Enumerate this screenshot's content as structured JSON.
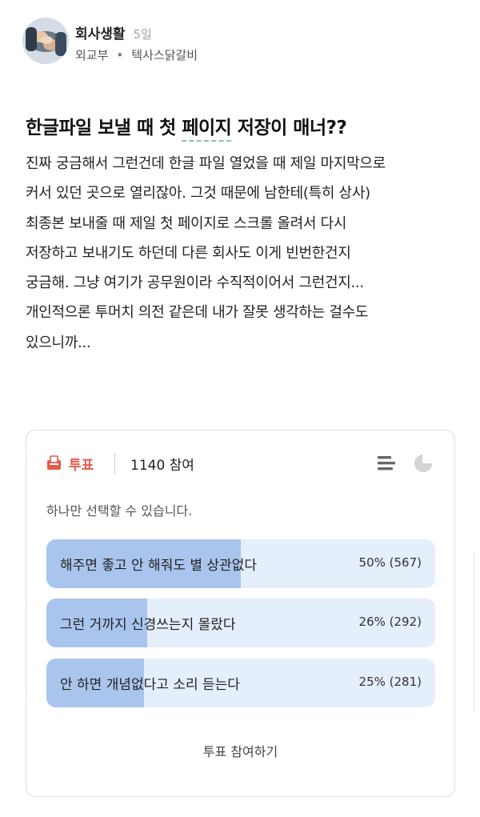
{
  "post": {
    "author": "회사생활",
    "time": "5일",
    "org": "외교부",
    "separator": "•",
    "nickname": "텍사스닭갈비",
    "title_before": "한글파일 보낼 때 첫 ",
    "title_underlined": "페이지",
    "title_after": " 저장이 매너??",
    "body_lines": [
      "진짜 궁금해서 그런건데 한글 파일 열었을 때 제일 마지막으로",
      "커서 있던 곳으로 열리잖아. 그것 때문에 남한테(특히 상사)",
      "최종본 보내줄 때 제일 첫 페이지로 스크롤 올려서 다시",
      "저장하고 보내기도 하던데 다른 회사도 이게 빈번한건지",
      "궁금해. 그냥 여기가 공무원이라 수직적이어서 그런건지...",
      "개인적으론 투머치 의전 같은데 내가 잘못 생각하는 걸수도",
      "있으니까..."
    ]
  },
  "poll": {
    "type_label": "투표",
    "participants": "1140 참여",
    "note": "하나만 선택할 수 있습니다.",
    "options": [
      {
        "label": "해주면 좋고 안 해줘도 별 상관없다",
        "result": "50% (567)",
        "percent": 50
      },
      {
        "label": "그런 거까지 신경쓰는지 몰랐다",
        "result": "26% (292)",
        "percent": 26
      },
      {
        "label": "안 하면 개념없다고 소리 듣는다",
        "result": "25% (281)",
        "percent": 25
      }
    ],
    "vote_button": "투표 참여하기",
    "icons": {
      "type": "ballot-box-icon",
      "list_view": "list-view-icon",
      "chart_view": "pie-chart-icon"
    },
    "colors": {
      "accent": "#e35a4a",
      "bar_fill": "#a9c5ee",
      "bar_track": "#e5eefb"
    }
  }
}
